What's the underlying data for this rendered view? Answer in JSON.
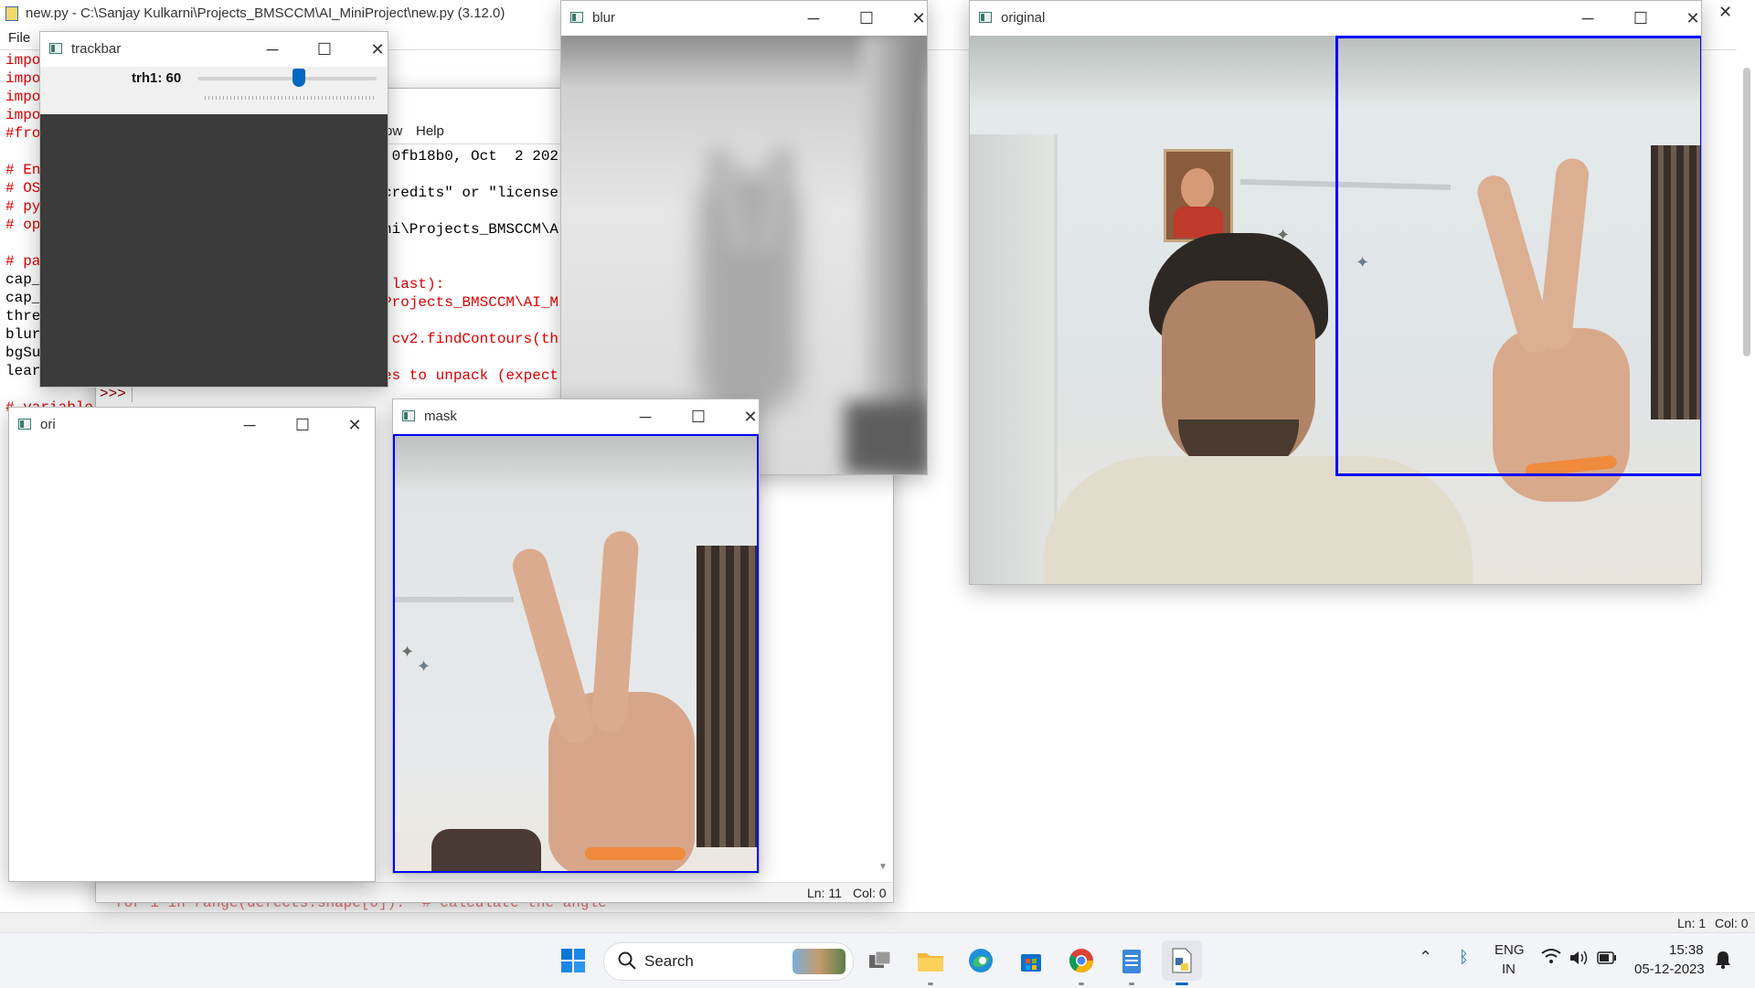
{
  "ide": {
    "title": "new.py - C:\\Sanjay Kulkarni\\Projects_BMSCCM\\AI_MiniProject\\new.py (3.12.0)",
    "menu_file": "File",
    "status_ln": "Ln: 1",
    "status_col": "Col: 0",
    "code_frags": [
      "impo",
      "impo",
      "impo",
      "impo",
      "#fro",
      "# En",
      "# OS",
      "# py",
      "# op",
      "# pa",
      "cap_",
      "cap_",
      "thre",
      "blur",
      "bgSu",
      "lear",
      "# variable"
    ],
    "bottom_code": "for i in range(defects.shape[0]):  # calculate the angle"
  },
  "shell": {
    "menu_help": "Help",
    "menu_frag": "ow",
    "lines": [
      {
        "text": ":0fb18b0, Oct  2 202",
        "color": "#000000"
      },
      {
        "text": "credits\" or \"license",
        "color": "#000000"
      },
      {
        "text": "ni\\Projects_BMSCCM\\A",
        "color": "#000000"
      },
      {
        "text": " last):",
        "color": "#dd0000"
      },
      {
        "text": "Projects_BMSCCM\\AI_M",
        "color": "#dd0000"
      },
      {
        "text": " cv2.findContours(th",
        "color": "#dd0000"
      },
      {
        "text": "es to unpack (expect",
        "color": "#dd0000"
      }
    ],
    "prompt": ">>>",
    "status_ln": "Ln: 11",
    "status_col": "Col: 0"
  },
  "trackbar_win": {
    "title": "trackbar",
    "label": "trh1: 60",
    "value": 60,
    "max": 255
  },
  "blur_win": {
    "title": "blur"
  },
  "original_win": {
    "title": "original"
  },
  "ori_win": {
    "title": "ori"
  },
  "mask_win": {
    "title": "mask"
  },
  "window_controls": {
    "minimize": "─",
    "maximize": "☐",
    "close": "✕"
  },
  "taskbar": {
    "search_placeholder": "Search",
    "lang_top": "ENG",
    "lang_bottom": "IN",
    "time": "15:38",
    "date": "05-12-2023",
    "apps": [
      "windows-start-icon",
      "task-view-icon",
      "file-explorer-icon",
      "edge-browser-icon",
      "microsoft-store-icon",
      "chrome-icon",
      "notepad-icon",
      "python-idle-icon"
    ]
  },
  "colors": {
    "taskbar_bg": "#f3f4f8",
    "roi_box": "#0000ff",
    "code_red": "#dd0000"
  }
}
